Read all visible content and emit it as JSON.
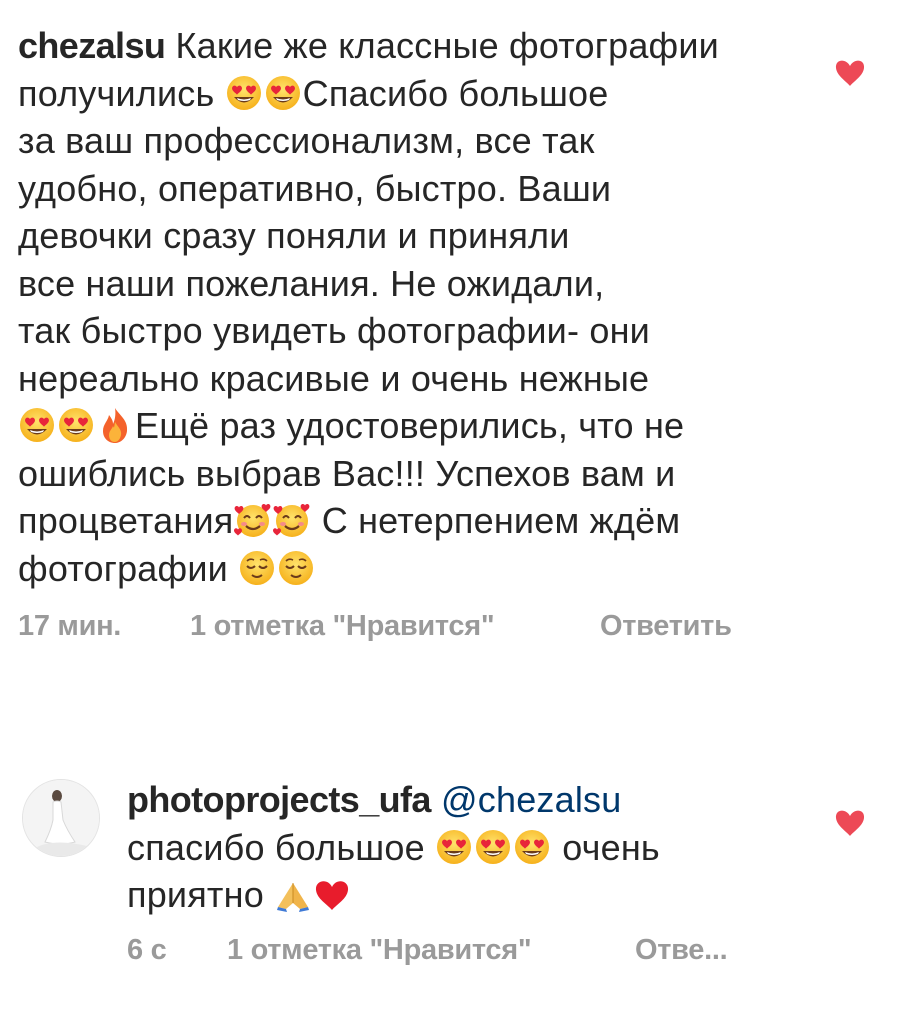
{
  "comments": [
    {
      "username": "chezalsu",
      "lines": {
        "l1": "Какие же классные фотографии",
        "l2a": "получились ",
        "l2b": "Спасибо большое",
        "l3": "за ваш профессионализм, все так",
        "l4": "удобно, оперативно, быстро. Ваши",
        "l5": "девочки сразу поняли  и приняли",
        "l6": "все наши пожелания. Не ожидали,",
        "l7": "так быстро увидеть фотографии- они",
        "l8": "нереально красивые и очень нежные",
        "l9": "Ещё раз удостоверились, что не",
        "l10": "ошиблись выбрав Вас!!! Успехов вам и",
        "l11a": "процветания",
        "l11b": " С нетерпением ждём",
        "l12": "фотографии "
      },
      "time": "17 мин.",
      "likes": "1 отметка \"Нравится\"",
      "reply": "Ответить"
    },
    {
      "username": "photoprojects_ufa",
      "mention": "@chezalsu",
      "lines": {
        "l1": "спасибо большое ",
        "l1b": " очень",
        "l2": "приятно "
      },
      "time": "6 с",
      "likes": "1 отметка \"Нравится\"",
      "reply": "Отве..."
    }
  ],
  "icons": {
    "like": "heart-filled-icon",
    "emoji_eyes": "heart-eyes-emoji",
    "emoji_fire": "fire-emoji",
    "emoji_hearts": "smiling-face-with-hearts-emoji",
    "emoji_relieved": "relieved-face-emoji",
    "emoji_pray": "folded-hands-emoji",
    "emoji_heart": "red-heart-emoji"
  },
  "colors": {
    "text": "#262626",
    "meta": "#9a9a9a",
    "mention": "#00376b",
    "like": "#ed4956"
  }
}
